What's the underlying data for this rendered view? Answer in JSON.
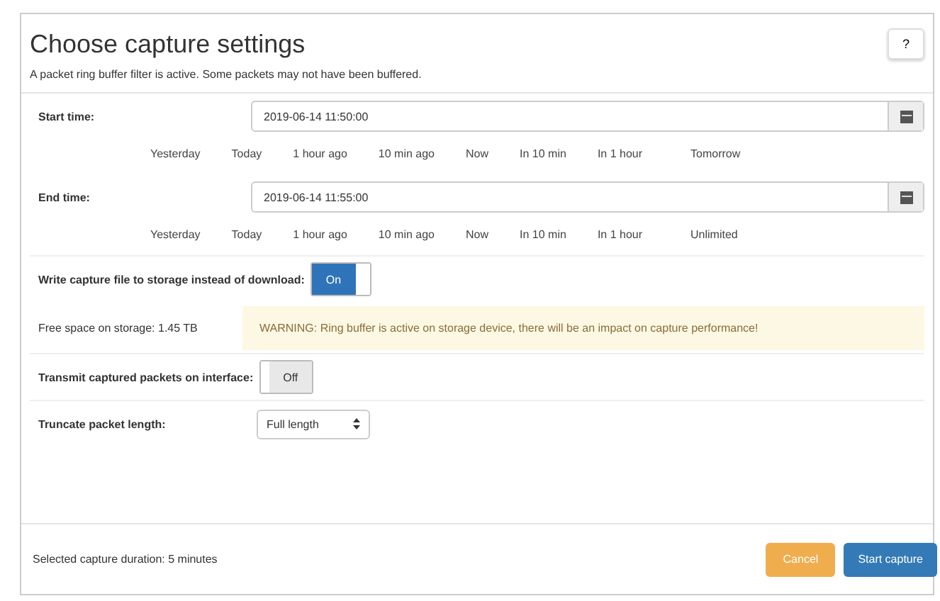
{
  "dialog": {
    "title": "Choose capture settings",
    "help_button": "?",
    "notice": "A packet ring buffer filter is active. Some packets may not have been buffered."
  },
  "start_time": {
    "label": "Start time:",
    "value": "2019-06-14 11:50:00",
    "shortcuts": [
      "Yesterday",
      "Today",
      "1 hour ago",
      "10 min ago",
      "Now",
      "In 10 min",
      "In 1 hour",
      "Tomorrow"
    ]
  },
  "end_time": {
    "label": "End time:",
    "value": "2019-06-14 11:55:00",
    "shortcuts": [
      "Yesterday",
      "Today",
      "1 hour ago",
      "10 min ago",
      "Now",
      "In 10 min",
      "In 1 hour",
      "Unlimited"
    ]
  },
  "write_to_storage": {
    "label": "Write capture file to storage instead of download:",
    "on": true,
    "state_label": "On"
  },
  "free_space": "Free space on storage: 1.45 TB",
  "warning": "WARNING: Ring buffer is active on storage device, there will be an impact on capture performance!",
  "transmit": {
    "label": "Transmit captured packets on interface:",
    "on": false,
    "state_label": "Off"
  },
  "truncate": {
    "label": "Truncate packet length:",
    "value": "Full length"
  },
  "footer": {
    "duration": "Selected capture duration: 5 minutes",
    "buttons": [
      {
        "kind": "warning",
        "label": "Cancel"
      },
      {
        "kind": "primary",
        "label": "Start capture"
      }
    ]
  }
}
